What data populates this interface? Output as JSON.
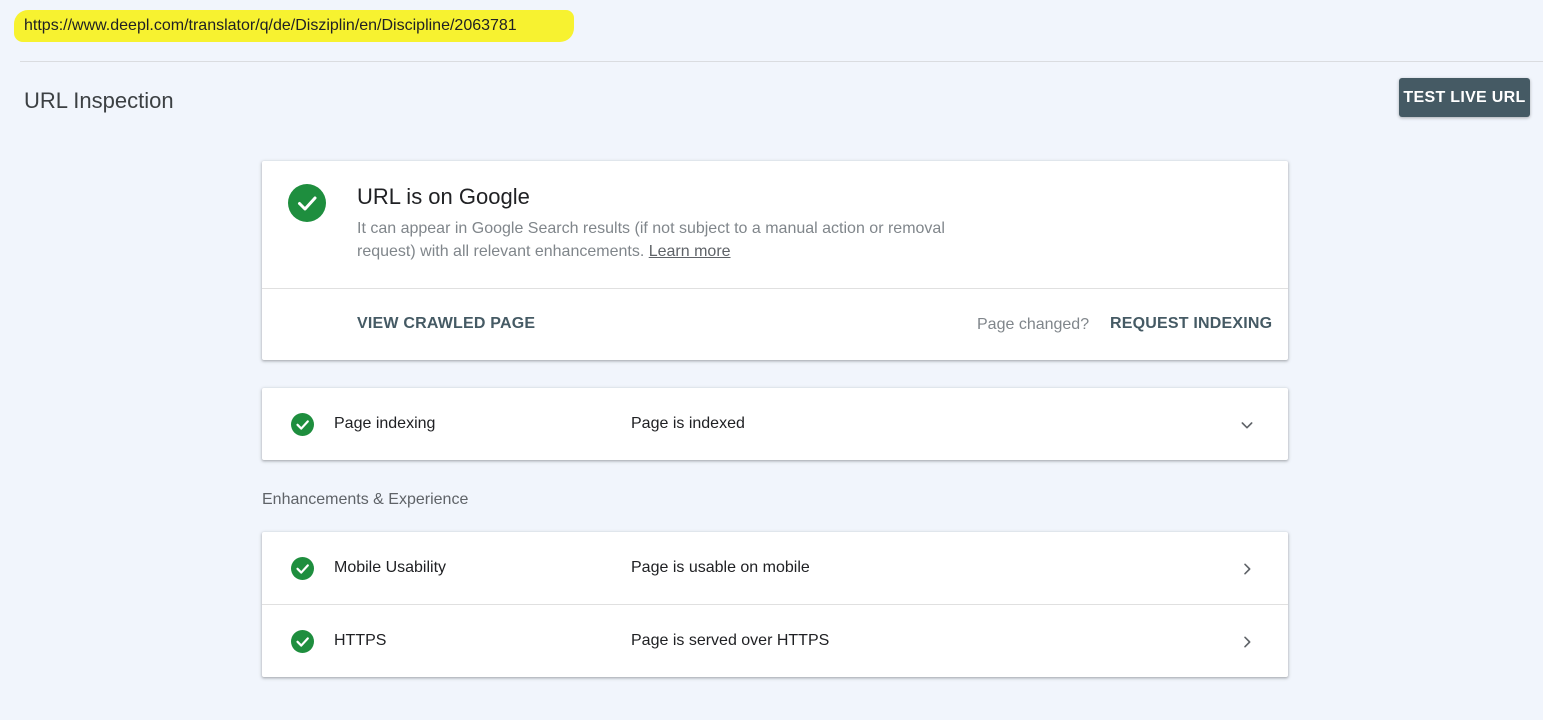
{
  "url_bar": {
    "url": "https://www.deepl.com/translator/q/de/Disziplin/en/Discipline/2063781"
  },
  "header": {
    "title": "URL Inspection",
    "test_live_label": "TEST LIVE URL"
  },
  "status_card": {
    "heading": "URL is on Google",
    "description": "It can appear in Google Search results (if not subject to a manual action or removal request) with all relevant enhancements.",
    "learn_more": "Learn more",
    "view_crawled_label": "VIEW CRAWLED PAGE",
    "page_changed": "Page changed?",
    "request_indexing_label": "REQUEST INDEXING"
  },
  "indexing": {
    "label": "Page indexing",
    "value": "Page is indexed"
  },
  "enhancements": {
    "section_title": "Enhancements & Experience",
    "items": [
      {
        "label": "Mobile Usability",
        "value": "Page is usable on mobile"
      },
      {
        "label": "HTTPS",
        "value": "Page is served over HTTPS"
      }
    ]
  },
  "colors": {
    "success": "#1e8e3e",
    "button_bg": "#455a64",
    "highlight": "#f7f230",
    "page_bg": "#f1f5fc"
  },
  "icons": {
    "status": "check-circle-icon",
    "expand": "chevron-down-icon",
    "open": "chevron-right-icon"
  }
}
